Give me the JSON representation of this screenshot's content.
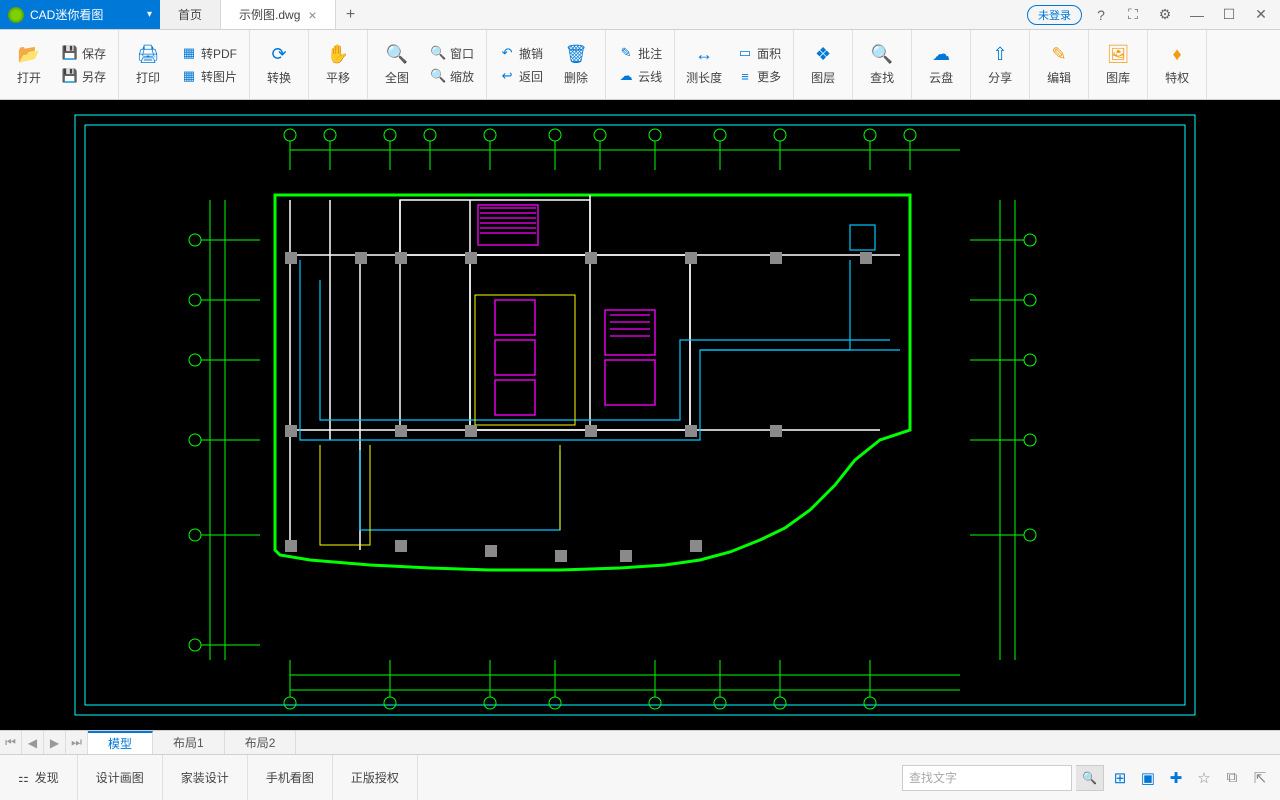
{
  "app": {
    "title": "CAD迷你看图"
  },
  "tabs": {
    "home": "首页",
    "file": "示例图.dwg"
  },
  "login_btn": "未登录",
  "toolbar": {
    "open": "打开",
    "save": "保存",
    "saveas": "另存",
    "print": "打印",
    "to_pdf": "转PDF",
    "to_img": "转图片",
    "convert": "转换",
    "pan": "平移",
    "full": "全图",
    "window": "窗口",
    "zoom": "缩放",
    "undo": "撤销",
    "back": "返回",
    "delete": "删除",
    "annotate": "批注",
    "cloud_line": "云线",
    "measure_len": "测长度",
    "area": "面积",
    "more": "更多",
    "layers": "图层",
    "find": "查找",
    "cloud": "云盘",
    "share": "分享",
    "edit": "编辑",
    "library": "图库",
    "privilege": "特权"
  },
  "layout_tabs": {
    "model": "模型",
    "layout1": "布局1",
    "layout2": "布局2"
  },
  "status": {
    "discover": "发现",
    "design": "设计画图",
    "home_design": "家装设计",
    "mobile": "手机看图",
    "license": "正版授权"
  },
  "search_placeholder": "查找文字"
}
